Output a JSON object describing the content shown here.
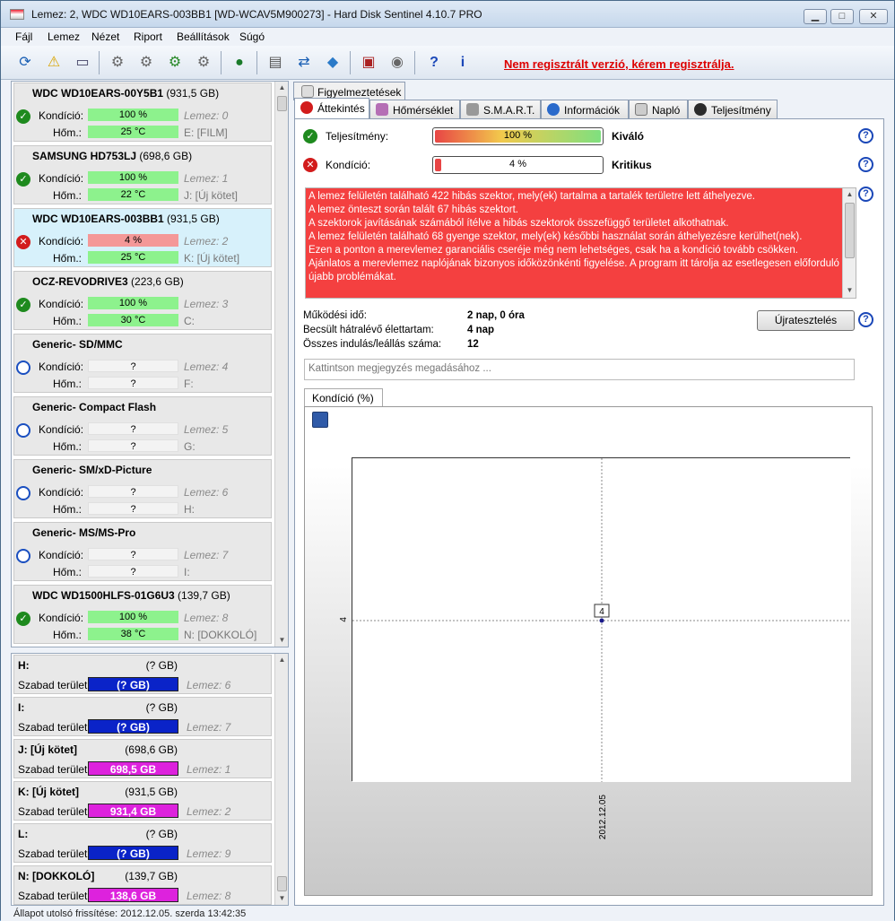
{
  "window": {
    "title": "Lemez: 2, WDC WD10EARS-003BB1 [WD-WCAV5M900273]  -  Hard Disk Sentinel 4.10.7 PRO",
    "min": "▁",
    "max": "□",
    "close": "✕"
  },
  "menu": [
    "Fájl",
    "Lemez",
    "Nézet",
    "Riport",
    "Beállítások",
    "Súgó"
  ],
  "toolbar": {
    "unregistered": "Nem regisztrált verzió, kérem regisztrálja."
  },
  "disks": [
    {
      "name": "WDC WD10EARS-00Y5B1",
      "size": "(931,5 GB)",
      "status": "ok",
      "cond_label": "Kondíció:",
      "cond": "100 %",
      "temp_label": "Hőm.:",
      "temp": "25 °C",
      "lemez": "Lemez: 0",
      "drive": "E: [FILM]",
      "bar": "g"
    },
    {
      "name": "SAMSUNG HD753LJ",
      "size": "(698,6 GB)",
      "status": "ok",
      "cond_label": "Kondíció:",
      "cond": "100 %",
      "temp_label": "Hőm.:",
      "temp": "22 °C",
      "lemez": "Lemez: 1",
      "drive": "J: [Új kötet]",
      "bar": "g"
    },
    {
      "name": "WDC WD10EARS-003BB1",
      "size": "(931,5 GB)",
      "status": "bad",
      "cond_label": "Kondíció:",
      "cond": "4 %",
      "temp_label": "Hőm.:",
      "temp": "25 °C",
      "lemez": "Lemez: 2",
      "drive": "K: [Új kötet]",
      "bar": "r"
    },
    {
      "name": "OCZ-REVODRIVE3",
      "size": "(223,6 GB)",
      "status": "ok",
      "cond_label": "Kondíció:",
      "cond": "100 %",
      "temp_label": "Hőm.:",
      "temp": "30 °C",
      "lemez": "Lemez: 3",
      "drive": "C:",
      "bar": "g"
    },
    {
      "name": "Generic- SD/MMC",
      "size": "",
      "status": "unk",
      "cond_label": "Kondíció:",
      "cond": "?",
      "temp_label": "Hőm.:",
      "temp": "?",
      "lemez": "Lemez: 4",
      "drive": "F:",
      "bar": "e"
    },
    {
      "name": "Generic- Compact Flash",
      "size": "",
      "status": "unk",
      "cond_label": "Kondíció:",
      "cond": "?",
      "temp_label": "Hőm.:",
      "temp": "?",
      "lemez": "Lemez: 5",
      "drive": "G:",
      "bar": "e"
    },
    {
      "name": "Generic- SM/xD-Picture",
      "size": "",
      "status": "unk",
      "cond_label": "Kondíció:",
      "cond": "?",
      "temp_label": "Hőm.:",
      "temp": "?",
      "lemez": "Lemez: 6",
      "drive": "H:",
      "bar": "e"
    },
    {
      "name": "Generic- MS/MS-Pro",
      "size": "",
      "status": "unk",
      "cond_label": "Kondíció:",
      "cond": "?",
      "temp_label": "Hőm.:",
      "temp": "?",
      "lemez": "Lemez: 7",
      "drive": "I:",
      "bar": "e"
    },
    {
      "name": "WDC WD1500HLFS-01G6U3",
      "size": "(139,7 GB)",
      "status": "ok",
      "cond_label": "Kondíció:",
      "cond": "100 %",
      "temp_label": "Hőm.:",
      "temp": "38 °C",
      "lemez": "Lemez: 8",
      "drive": "N: [DOKKOLÓ]",
      "bar": "g"
    }
  ],
  "volumes": [
    {
      "name": "H:",
      "size": "(? GB)",
      "free_label": "Szabad terület",
      "free": "(? GB)",
      "lemez": "Lemez: 6",
      "color": "blue"
    },
    {
      "name": "I:",
      "size": "(? GB)",
      "free_label": "Szabad terület",
      "free": "(? GB)",
      "lemez": "Lemez: 7",
      "color": "blue"
    },
    {
      "name": "J: [Új kötet]",
      "size": "(698,6 GB)",
      "free_label": "Szabad terület",
      "free": "698,5 GB",
      "lemez": "Lemez: 1",
      "color": "mag"
    },
    {
      "name": "K: [Új kötet]",
      "size": "(931,5 GB)",
      "free_label": "Szabad terület",
      "free": "931,4 GB",
      "lemez": "Lemez: 2",
      "color": "mag"
    },
    {
      "name": "L:",
      "size": "(? GB)",
      "free_label": "Szabad terület",
      "free": "(? GB)",
      "lemez": "Lemez: 9",
      "color": "blue"
    },
    {
      "name": "N: [DOKKOLÓ]",
      "size": "(139,7 GB)",
      "free_label": "Szabad terület",
      "free": "138,6 GB",
      "lemez": "Lemez: 8",
      "color": "mag"
    }
  ],
  "status_bar": "Állapot utolsó frissítése: 2012.12.05. szerda 13:42:35",
  "tabs": {
    "alerts": "Figyelmeztetések",
    "items": [
      "Áttekintés",
      "Hőmérséklet",
      "S.M.A.R.T.",
      "Információk",
      "Napló",
      "Teljesítmény"
    ]
  },
  "overview": {
    "perf_label": "Teljesítmény:",
    "perf_value": "100 %",
    "perf_fraction": 1.0,
    "perf_rating": "Kiváló",
    "cond_label": "Kondíció:",
    "cond_value": "4 %",
    "cond_fraction": 0.04,
    "cond_rating": "Kritikus",
    "message": [
      "A lemez felületén található 422 hibás szektor, mely(ek) tartalma a tartalék területre lett áthelyezve.",
      "A lemez önteszt során talált 67 hibás szektort.",
      "A szektorok javításának számából ítélve a hibás szektorok összefüggő területet alkothatnak.",
      "A lemez felületén található 68 gyenge szektor, mely(ek) későbbi használat során áthelyezésre kerülhet(nek).",
      "Ezen a ponton a merevlemez garanciális cseréje még nem lehetséges, csak ha a kondíció tovább csökken.",
      "Ajánlatos a merevlemez naplójának bizonyos időközönkénti figyelése. A program itt tárolja az esetlegesen előforduló újabb problémákat."
    ],
    "uptime_label": "Működési idő:",
    "uptime": "2 nap, 0 óra",
    "remaining_label": "Becsült hátralévő élettartam:",
    "remaining": "4 nap",
    "starts_label": "Összes indulás/leállás száma:",
    "starts": "12",
    "retest": "Újratesztelés",
    "note_placeholder": "Kattintson megjegyzés megadásához ..."
  },
  "chart_data": {
    "type": "line",
    "title": "Kondíció  (%)",
    "x": [
      "2012.12.05"
    ],
    "series": [
      {
        "values": [
          4
        ]
      }
    ],
    "ytick": "4",
    "point_label": "4"
  },
  "colors": {
    "perf_fill": "#7fe07f",
    "cond_fill": "#e84545",
    "message_bg": "#f44040",
    "accent": "#1a47b8"
  }
}
